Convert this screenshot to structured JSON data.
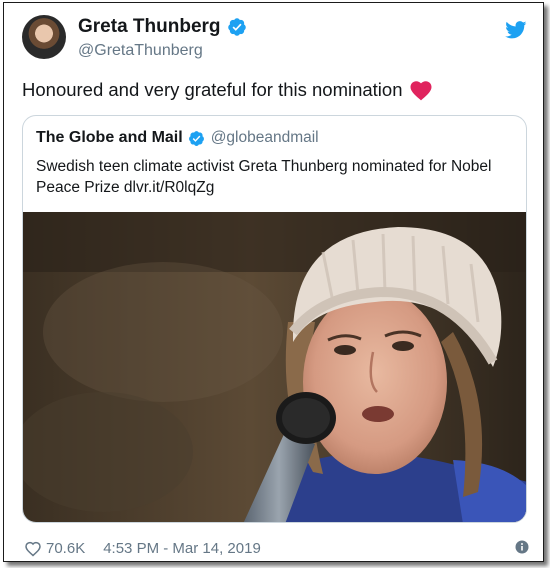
{
  "tweet": {
    "display_name": "Greta Thunberg",
    "handle": "@GretaThunberg",
    "text": "Honoured and very grateful for this nomination",
    "likes": "70.6K",
    "timestamp": "4:53 PM - Mar 14, 2019"
  },
  "quoted_tweet": {
    "display_name": "The Globe and Mail",
    "handle": "@globeandmail",
    "text": "Swedish teen climate activist Greta Thunberg nominated for Nobel Peace Prize dlvr.it/R0lqZg"
  },
  "icons": {
    "verified": "verified-badge-icon",
    "brand": "twitter-bird-icon",
    "heart": "red-heart-emoji-icon",
    "like": "heart-outline-icon",
    "info": "info-icon"
  },
  "colors": {
    "accent": "#1da1f2",
    "secondary_text": "#657786",
    "heart_red": "#e0245e",
    "border": "#ccd6dd"
  }
}
